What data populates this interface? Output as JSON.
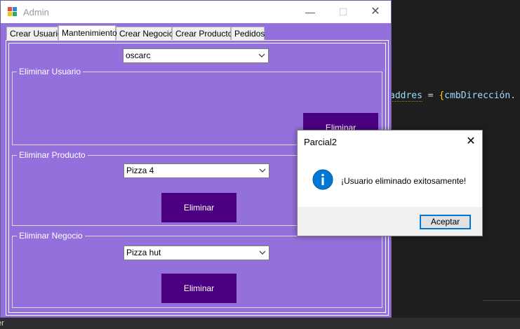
{
  "ide": {
    "code_line": {
      "ident": "addres",
      "op": " = ",
      "brace": "{",
      "rest": "cmbDirección."
    },
    "status_text": "er"
  },
  "window": {
    "title": "Admin",
    "controls": {
      "minimize": "—",
      "maximize": "☐",
      "close": "✕"
    }
  },
  "tabs": [
    {
      "label": "Crear Usuario"
    },
    {
      "label": "Mantenimiento",
      "active": true
    },
    {
      "label": "Crear Negocio"
    },
    {
      "label": "Crear Producto"
    },
    {
      "label": "Pedidos"
    }
  ],
  "maintenance": {
    "user_combo": {
      "value": "oscarc"
    },
    "delete_user": {
      "label": "Eliminar Usuario",
      "button": "Eliminar"
    },
    "delete_product": {
      "label": "Eliminar Producto",
      "combo_value": "Pizza 4",
      "button": "Eliminar"
    },
    "delete_business": {
      "label": "Eliminar Negocio",
      "combo_value": "Pizza hut",
      "button": "Eliminar"
    }
  },
  "dialog": {
    "title": "Parcial2",
    "close": "✕",
    "icon": "info-icon",
    "message": "¡Usuario eliminado exitosamente!",
    "ok_button": "Aceptar"
  },
  "colors": {
    "form_background": "#9370db",
    "button_background": "#4b0082",
    "dialog_accent": "#0078d7",
    "ide_background": "#1e1e1e"
  }
}
